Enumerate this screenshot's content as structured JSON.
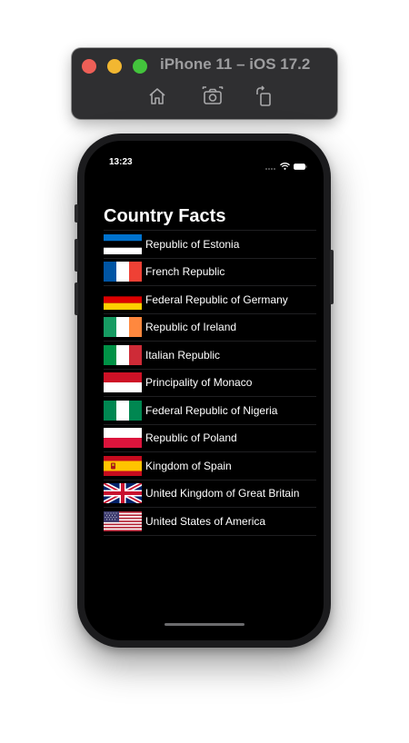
{
  "window": {
    "title": "iPhone 11 – iOS 17.2"
  },
  "toolbar": {
    "icons": [
      "home-icon",
      "screenshot-icon",
      "rotate-icon"
    ]
  },
  "status_bar": {
    "time": "13:23"
  },
  "screen": {
    "title": "Country Facts"
  },
  "countries": [
    {
      "name": "Republic of Estonia",
      "flag": "estonia-flag-icon"
    },
    {
      "name": "French Republic",
      "flag": "france-flag-icon"
    },
    {
      "name": "Federal Republic of Germany",
      "flag": "germany-flag-icon"
    },
    {
      "name": "Republic of Ireland",
      "flag": "ireland-flag-icon"
    },
    {
      "name": "Italian Republic",
      "flag": "italy-flag-icon"
    },
    {
      "name": "Principality of Monaco",
      "flag": "monaco-flag-icon"
    },
    {
      "name": "Federal Republic of Nigeria",
      "flag": "nigeria-flag-icon"
    },
    {
      "name": "Republic of Poland",
      "flag": "poland-flag-icon"
    },
    {
      "name": "Kingdom of Spain",
      "flag": "spain-flag-icon"
    },
    {
      "name": "United Kingdom of Great Britain",
      "flag": "uk-flag-icon"
    },
    {
      "name": "United States of America",
      "flag": "usa-flag-icon"
    }
  ],
  "colors": {
    "background": "#000000",
    "text": "#ffffff",
    "separator": "#1f1f21",
    "toolbar": "#2f2f31"
  }
}
